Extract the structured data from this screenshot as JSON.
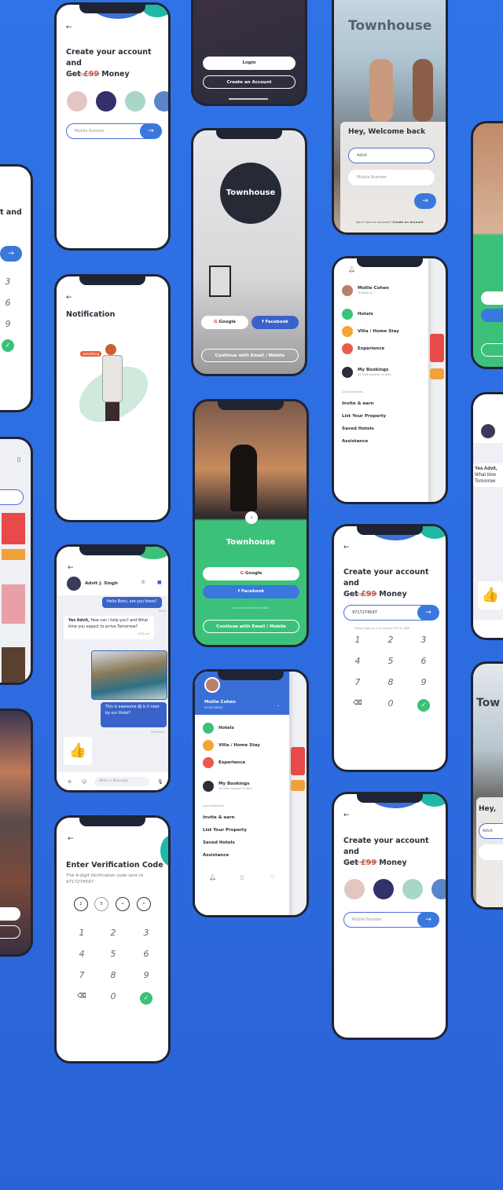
{
  "colors": {
    "background": "#2f73e6",
    "primary": "#3a78de",
    "accent_red": "#e8513b",
    "green": "#3cc17a",
    "teal": "#1fb8a6",
    "dark": "#1e2434"
  },
  "signup": {
    "title_pre": "Create your account and",
    "title_get": "Get",
    "amount": "£99",
    "title_post": "Money",
    "subtitle": "It's Super Quick",
    "placeholder": "Mobile Number",
    "back_icon": "arrow-left",
    "go_icon": "arrow-right"
  },
  "landing": {
    "login": "Login",
    "create": "Create an Account"
  },
  "welcome": {
    "brand": "Townhouse",
    "title": "Hey, Welcome back",
    "name_value": "Advit",
    "mobile_placeholder": "Mobile Number",
    "footer": "Don't have an account?",
    "footer_link": "Create an Account"
  },
  "splash": {
    "brand": "Townhouse",
    "google": "Google",
    "facebook": "Facebook",
    "continue": "Continue with Email / Mobile"
  },
  "notification": {
    "title": "Notification",
    "bubble": "something"
  },
  "menu": {
    "user": "Mollie Cohen",
    "handle": "@mollie.co",
    "phone": "91742-88530",
    "items": [
      "Hotels",
      "Villa / Home Stay",
      "Experience"
    ],
    "bookings": "My Bookings",
    "bookings_sub": "16 hotel booked till date",
    "quick_label": "Quick Searches",
    "quick": [
      "Invite & earn",
      "List Your Property",
      "Saved Hotels",
      "Assistance"
    ]
  },
  "chat": {
    "name": "Advit J. Singh",
    "m1": "Hello Boris, are you there?",
    "seen": "Seen",
    "m2_bold": "Yes Advit,",
    "m2": "How can i help you? and What time you expect to arrive Tomorrow?",
    "time": "6:50 pm",
    "m3": "This is awesome 😱 Is it near by our Hotel?",
    "delivered": "Delivered",
    "placeholder": "Write a Message"
  },
  "green": {
    "brand": "Townhouse",
    "google": "Google",
    "facebook": "Facebook",
    "divider": "or use your email / mobile",
    "continue": "Continue with Email / Mobile"
  },
  "keypad": {
    "number": "9717274597",
    "hint": "Please Sign as ✔ to receive OTP on SMS",
    "keys": [
      "1",
      "2",
      "3",
      "4",
      "5",
      "6",
      "7",
      "8",
      "9",
      "0"
    ]
  },
  "verify": {
    "title": "Enter Verification Code",
    "sub": "The 4-digit Verification code sent to",
    "number": "9717274597",
    "code": [
      "2",
      "5",
      "•",
      "•"
    ]
  },
  "partials": {
    "left_title": "t and",
    "left_keys": [
      "3",
      "6",
      "9"
    ],
    "right_chat": "Yes Advit,",
    "right_chat2": "What time",
    "right_chat3": "Tomorrow",
    "right_brand": "Tow",
    "right_hey": "Hey,",
    "right_advit": "Advit"
  }
}
